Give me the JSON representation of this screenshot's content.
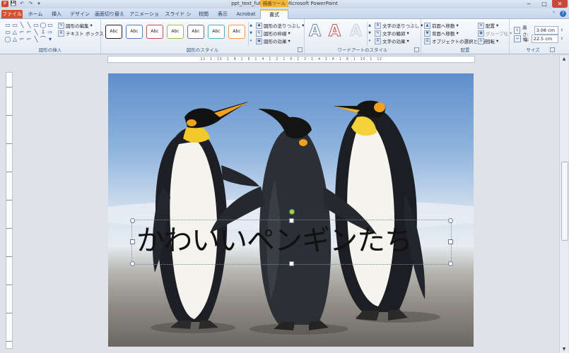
{
  "window": {
    "title": "ppt_text_futieri.pptx - Microsoft PowerPoint",
    "context_tab_header": "描画ツール",
    "controls": [
      "─",
      "□",
      "✕"
    ]
  },
  "qat": [
    "P",
    "💾",
    "↶",
    "↷",
    "▾"
  ],
  "tabs": [
    "ファイル",
    "ホーム",
    "挿入",
    "デザイン",
    "画面切り替え",
    "アニメーション",
    "スライド ショー",
    "校閲",
    "表示",
    "Acrobat",
    "書式"
  ],
  "active_tab": "書式",
  "ribbon": {
    "insert_shapes": {
      "label": "図形の挿入",
      "edit_shape": "図形の編集",
      "text_box": "テキスト ボックス",
      "shape_icons": [
        "▭",
        "▭",
        "╲",
        "╲",
        "▭",
        "◯",
        "▭",
        "▭",
        "△",
        "⌐",
        "⌐",
        "╲",
        "⇩",
        "⇨",
        "◯",
        "△",
        "⌐",
        "⌐",
        "╲",
        "⌒",
        "▾"
      ]
    },
    "shape_styles": {
      "label": "図形のスタイル",
      "style_label": "Abc",
      "fill": "図形の塗りつぶし",
      "outline": "図形の枠線",
      "effects": "図形の効果"
    },
    "wordart": {
      "label": "ワードアートのスタイル",
      "letter": "A",
      "text_fill": "文字の塗りつぶし",
      "text_outline": "文字の輪郭",
      "text_effects": "文字の効果"
    },
    "arrange": {
      "label": "配置",
      "bring_forward": "前面へ移動",
      "send_backward": "背面へ移動",
      "selection_pane": "オブジェクトの選択と表示",
      "align": "配置",
      "group": "グループ化",
      "rotate": "回転"
    },
    "size": {
      "label": "サイズ",
      "height_label": "高さ:",
      "height_value": "3.08 cm",
      "width_label": "幅:",
      "width_value": "22.5 cm"
    }
  },
  "ruler_h": "12 · 1 · 10 · 1 · 8 · 1 · 6 · 1 · 4 · 1 · 2 · 1 · 0 · 1 · 2 · 1 · 4 · 1 · 6 · 1 · 8 · 1 · 10 · 1 · 12",
  "slide": {
    "textbox_text": "かわいいペンギンたち"
  },
  "colors": {
    "file_tab": "#d4502e",
    "context_tab": "#f2b73e",
    "accent_blue": "#2d6fc2"
  }
}
